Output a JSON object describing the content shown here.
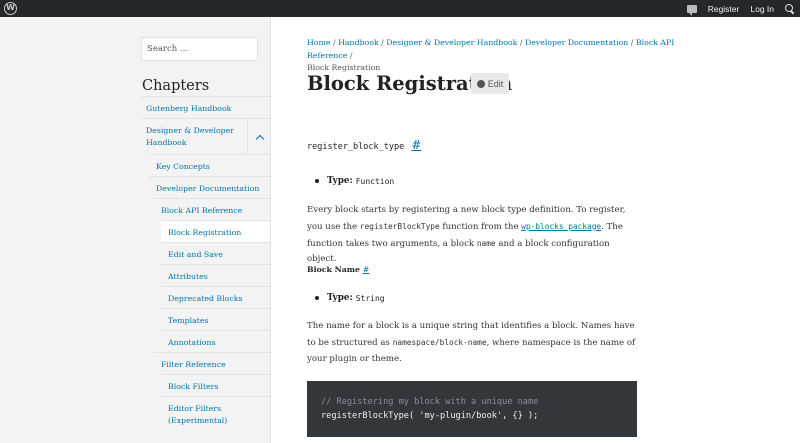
{
  "topbar": {
    "logo": "W",
    "register": "Register",
    "login": "Log In"
  },
  "sidebar": {
    "search_placeholder": "Search ...",
    "chapters_title": "Chapters",
    "items": [
      {
        "label": "Gutenberg Handbook"
      },
      {
        "label": "Designer & Developer Handbook"
      },
      {
        "label": "Key Concepts"
      },
      {
        "label": "Developer Documentation"
      },
      {
        "label": "Block API Reference"
      },
      {
        "label": "Block Registration"
      },
      {
        "label": "Edit and Save"
      },
      {
        "label": "Attributes"
      },
      {
        "label": "Deprecated Blocks"
      },
      {
        "label": "Templates"
      },
      {
        "label": "Annotations"
      },
      {
        "label": "Filter Reference"
      },
      {
        "label": "Block Filters"
      },
      {
        "label": "Editor Filters (Experimental)"
      }
    ]
  },
  "breadcrumb": {
    "home": "Home",
    "handbook": "Handbook",
    "designer": "Designer & Developer Handbook",
    "devdocs": "Developer Documentation",
    "blockapi": "Block API Reference",
    "current": "Block Registration",
    "sep": " / "
  },
  "main": {
    "title": "Block Registration",
    "edit_label": "Edit",
    "func_name": "register_block_type",
    "hash": "#",
    "type_label": "Type:",
    "type_value_function": "Function",
    "para1_a": "Every block starts by registering a new block type definition. To register, you use the ",
    "para1_code": "registerBlockType",
    "para1_b": " function from the ",
    "para1_link": "wp-blocks package",
    "para1_c": ". The function takes two arguments, a block ",
    "para1_name": "name",
    "para1_d": " and a block configuration object.",
    "block_name_heading": "Block Name",
    "type_value_string": "String",
    "para2_a": "The name for a block is a unique string that identifies a block. Names have to be structured as ",
    "para2_code": "namespace/block-name",
    "para2_b": ", where namespace is the name of your plugin or theme.",
    "code_comment": "// Registering my block with a unique name",
    "code_line": "registerBlockType( 'my-plugin/book', {} );"
  }
}
